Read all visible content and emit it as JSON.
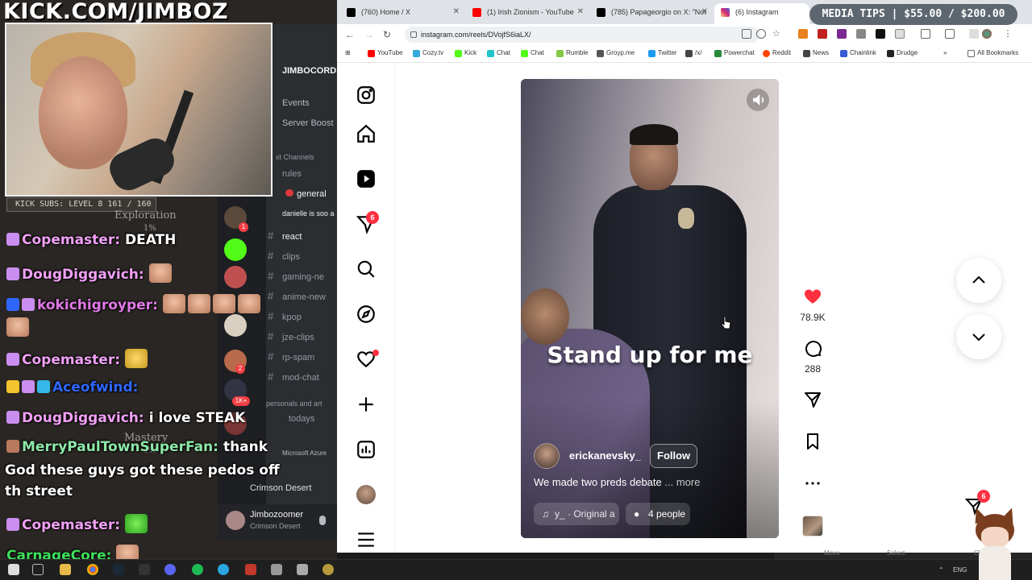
{
  "stream": {
    "banner": "KICK.COM/JIMBOZ",
    "sub_bar": "KICK SUBS: LEVEL 8 161 / 160",
    "media_tips": "MEDIA TIPS | $55.00 / $200.00",
    "faint_texts": [
      "Exploration",
      "1%",
      "Mastery",
      "1%"
    ]
  },
  "discord": {
    "server_name": "JIMBOCORD",
    "server_items": [
      "Events",
      "Server Boost"
    ],
    "channel_header": "xt Channels",
    "channels": [
      {
        "name": "rules",
        "hash": ""
      },
      {
        "name": "general",
        "hash": ""
      },
      {
        "name": "danielle is soo a",
        "hash": ""
      },
      {
        "name": "react",
        "hash": "#"
      },
      {
        "name": "clips",
        "hash": "#"
      },
      {
        "name": "gaming-ne",
        "hash": "#"
      },
      {
        "name": "anime-new",
        "hash": "#"
      },
      {
        "name": "kpop",
        "hash": "#"
      },
      {
        "name": "jze-clips",
        "hash": "#"
      },
      {
        "name": "rp-spam",
        "hash": "#"
      },
      {
        "name": "mod-chat",
        "hash": "#"
      }
    ],
    "section_personal": "personals and art",
    "channel_todays": "todays",
    "azure_text": "Microsoft Azure",
    "voice_channel": "Crimson Desert",
    "user_name": "Jimbozoomer",
    "user_status": "Crimson Desert",
    "guild_badges": [
      "1",
      "2",
      "1K+"
    ]
  },
  "chat": {
    "lines": [
      {
        "user": "Copemaster:",
        "msg": "DEATH",
        "color": "#f0a0f5"
      },
      {
        "user": "DougDiggavich:",
        "msg": "",
        "color": "#f0a0f5"
      },
      {
        "user": "kokichigroyper:",
        "msg": "",
        "color": "#e078e8"
      },
      {
        "user": "Copemaster:",
        "msg": "",
        "color": "#f0a0f5"
      },
      {
        "user": "Aceofwind:",
        "msg": "",
        "color": "#2f66ff"
      },
      {
        "user": "DougDiggavich:",
        "msg": "i love STEAK",
        "color": "#f0a0f5"
      },
      {
        "user": "MerryPaulTownSuperFan:",
        "msg": "thank",
        "color": "#8ee8a8"
      }
    ],
    "wrapped": "God these guys got these pedos off th street",
    "tail": [
      {
        "user": "Copemaster:",
        "msg": "",
        "color": "#f0a0f5"
      },
      {
        "user": "CarnageCore:",
        "msg": "",
        "color": "#3de05c"
      }
    ]
  },
  "browser": {
    "tabs": [
      {
        "title": "(760) Home / X",
        "fav_color": "#000000"
      },
      {
        "title": "(1) Irish Zionism - YouTube",
        "fav_color": "#ff0000"
      },
      {
        "title": "(785) Papageorgio on X: \"Not",
        "fav_color": "#000000"
      },
      {
        "title": "(6) Instagram",
        "fav_color": "#d62976"
      }
    ],
    "url": "instagram.com/reels/DVojfS6iaLX/",
    "bookmarks": [
      {
        "label": "YouTube",
        "color": "#ff0000"
      },
      {
        "label": "Cozy.tv",
        "color": "#35a9d9"
      },
      {
        "label": "Kick",
        "color": "#53fc18"
      },
      {
        "label": "Chat",
        "color": "#23c4c9"
      },
      {
        "label": "Chat",
        "color": "#53fc18"
      },
      {
        "label": "Rumble",
        "color": "#85c742"
      },
      {
        "label": "Groyp.me",
        "color": "#555555"
      },
      {
        "label": "Twitter",
        "color": "#1d9bf0"
      },
      {
        "label": "/x/",
        "color": "#444444"
      },
      {
        "label": "Powerchat",
        "color": "#2a8a3c"
      },
      {
        "label": "Reddit",
        "color": "#ff4500"
      },
      {
        "label": "News",
        "color": "#444444"
      },
      {
        "label": "Chainlink",
        "color": "#375bd2"
      },
      {
        "label": "Drudge",
        "color": "#222222"
      }
    ],
    "all_bookmarks": "All Bookmarks"
  },
  "instagram": {
    "rail": {
      "messages_badge": "6",
      "icons": [
        "instagram-logo-icon",
        "home-icon",
        "reels-icon",
        "messages-icon",
        "search-icon",
        "explore-icon",
        "notifications-icon",
        "create-icon",
        "dashboard-icon",
        "profile-avatar",
        "more-menu-icon"
      ]
    },
    "reel": {
      "caption_overlay": "Stand up for me",
      "author": "erickanevsky_",
      "follow_label": "Follow",
      "description": "We made two preds debate",
      "more_label": "... more",
      "audio_label": "y_ · Original a",
      "people_label": "4 people"
    },
    "actions": {
      "likes": "78.9K",
      "comments": "288",
      "liked": true,
      "like_color": "#ff3040"
    },
    "float_dm_badge": "6"
  },
  "taskbar": {
    "lang": "ENG",
    "overlay_labels": [
      "Move",
      "Select",
      "Close"
    ]
  },
  "colors": {
    "ig_red": "#ff3040",
    "tab_bar": "#dfe3e8",
    "chrome_bg": "#ffffff"
  }
}
